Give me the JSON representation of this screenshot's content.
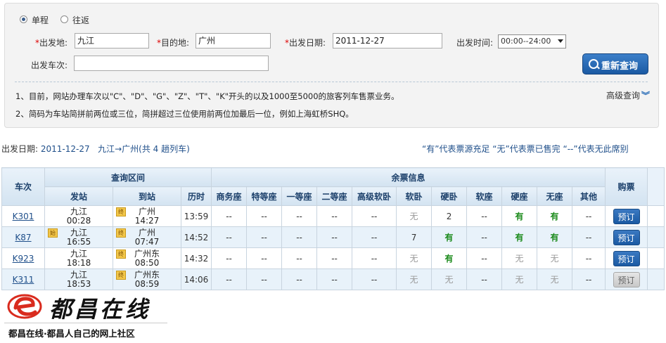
{
  "query": {
    "trip_type": {
      "one_way": "单程",
      "round_trip": "往返",
      "selected": "one_way"
    },
    "from_label": "出发地:",
    "from_value": "九江",
    "to_label": "目的地:",
    "to_value": "广州",
    "date_label": "出发日期:",
    "date_value": "2011-12-27",
    "time_label": "出发时间:",
    "time_value": "00:00--24:00",
    "train_no_label": "出发车次:",
    "train_no_value": "",
    "required_mark": "*",
    "search_button": "重新查询",
    "advanced": "高级查询",
    "notes": [
      "1、目前，网站办理车次以\"C\"、\"D\"、\"G\"、\"Z\"、\"T\"、\"K\"开头的以及1000至5000的旅客列车售票业务。",
      "2、简码为车站简拼前两位或三位，简拼超过三位使用前两位加最后一位，例如上海虹桥SHQ。"
    ]
  },
  "summary": {
    "date_label": "出发日期:",
    "date": "2011-12-27",
    "route": "九江→广州",
    "count_prefix": "(共",
    "count": "4",
    "count_suffix": "趟列车)",
    "legend": "“有”代表票源充足 “无”代表票已售完 “--”代表无此席别"
  },
  "table": {
    "h_train": "车次",
    "h_range": "查询区间",
    "h_seats": "余票信息",
    "h_buy": "购票",
    "h_dep": "发站",
    "h_arr": "到站",
    "h_dur": "历时",
    "seat_cols": [
      "商务座",
      "特等座",
      "一等座",
      "二等座",
      "高级软卧",
      "软卧",
      "硬卧",
      "软座",
      "硬座",
      "无座",
      "其他"
    ],
    "rows": [
      {
        "train": "K301",
        "dep_tag": "",
        "dep_station": "九江",
        "dep_time": "00:28",
        "arr_tag": "终",
        "arr_station": "广州",
        "arr_time": "14:27",
        "duration": "13:59",
        "seats": [
          "--",
          "--",
          "--",
          "--",
          "--",
          "无",
          "2",
          "--",
          "有",
          "有",
          "--"
        ],
        "book": "预订",
        "book_enabled": true
      },
      {
        "train": "K87",
        "dep_tag": "始",
        "dep_station": "九江",
        "dep_time": "16:55",
        "arr_tag": "终",
        "arr_station": "广州",
        "arr_time": "07:47",
        "duration": "14:52",
        "seats": [
          "--",
          "--",
          "--",
          "--",
          "--",
          "7",
          "有",
          "--",
          "有",
          "有",
          "--"
        ],
        "book": "预订",
        "book_enabled": true
      },
      {
        "train": "K923",
        "dep_tag": "",
        "dep_station": "九江",
        "dep_time": "18:18",
        "arr_tag": "终",
        "arr_station": "广州东",
        "arr_time": "08:50",
        "duration": "14:32",
        "seats": [
          "--",
          "--",
          "--",
          "--",
          "--",
          "无",
          "有",
          "--",
          "无",
          "无",
          "--"
        ],
        "book": "预订",
        "book_enabled": true
      },
      {
        "train": "K311",
        "dep_tag": "",
        "dep_station": "九江",
        "dep_time": "18:53",
        "arr_tag": "终",
        "arr_station": "广州东",
        "arr_time": "08:59",
        "duration": "14:06",
        "seats": [
          "--",
          "--",
          "--",
          "--",
          "--",
          "无",
          "无",
          "--",
          "无",
          "无",
          "--"
        ],
        "book": "预订",
        "book_enabled": false
      }
    ]
  },
  "watermark": {
    "name": "都昌在线",
    "tagline": "都昌在线·都昌人自己的网上社区",
    "brand_color": "#d92b1e"
  }
}
